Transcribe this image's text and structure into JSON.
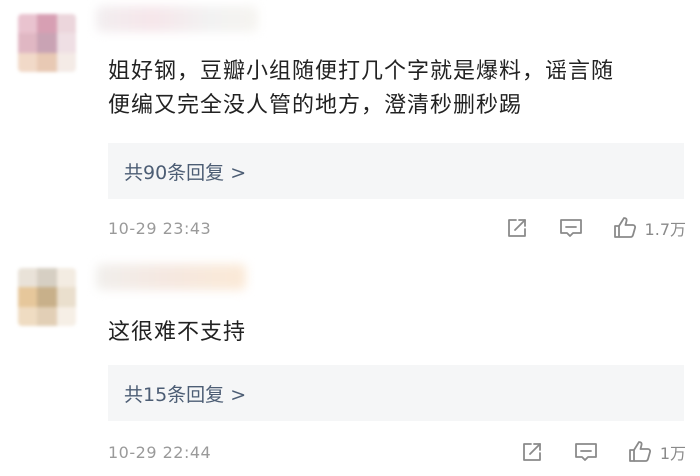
{
  "comments": [
    {
      "text_line1": "姐好钢，豆瓣小组随便打几个字就是爆料，谣言随",
      "text_line2": "便编又完全没人管的地方，澄清秒删秒踢",
      "reply_label": "共90条回复 >",
      "time": "10-29 23:43",
      "like_count": "1.7万",
      "icons": [
        "share-icon",
        "comment-icon",
        "like-icon"
      ],
      "avatar_colors": [
        "#e9c3cf",
        "#d79fb3",
        "#ecd6dc",
        "#e0b7c3",
        "#c9a3b4",
        "#efdfe4",
        "#f1d9c8",
        "#e8c9b4",
        "#f4ebe6"
      ]
    },
    {
      "text_line1": "这很难不支持",
      "text_line2": "",
      "reply_label": "共15条回复 >",
      "time": "10-29 22:44",
      "like_count": "1万",
      "icons": [
        "share-icon",
        "comment-icon",
        "like-icon"
      ],
      "avatar_colors": [
        "#e9e2d8",
        "#d6cfc3",
        "#f3ece2",
        "#e6c79b",
        "#c8b08a",
        "#eadfcd",
        "#efdcc2",
        "#e2cfb6",
        "#f6efe6"
      ]
    }
  ],
  "colors": {
    "text": "#222222",
    "reply_text": "#4c5d74",
    "reply_bg": "#f5f6f7",
    "meta": "#9a9a9a"
  }
}
